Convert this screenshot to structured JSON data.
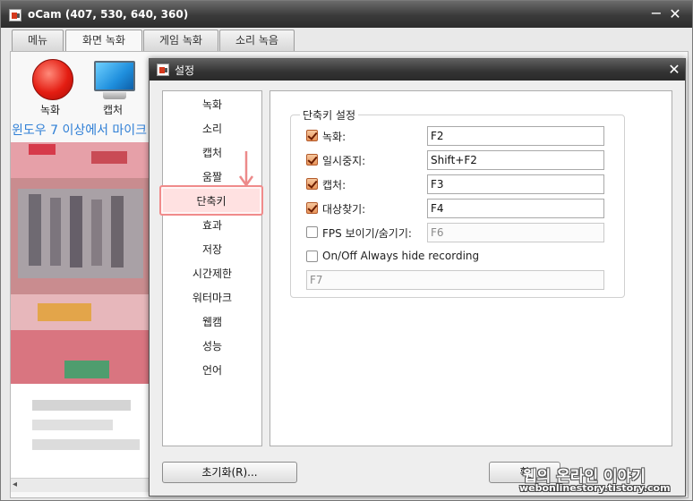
{
  "main_window": {
    "title": "oCam (407, 530, 640, 360)",
    "minimize": "−",
    "close": "✕",
    "tabs": [
      {
        "label": "메뉴"
      },
      {
        "label": "화면 녹화"
      },
      {
        "label": "게임 녹화"
      },
      {
        "label": "소리 녹음"
      }
    ],
    "toolbar": {
      "record_label": "녹화",
      "capture_label": "캡처"
    },
    "banner_text": "윈도우 7 이상에서 마이크",
    "scroll_left": "◂"
  },
  "settings_dialog": {
    "title": "설정",
    "close": "✕",
    "nav_items": [
      {
        "label": "녹화"
      },
      {
        "label": "소리"
      },
      {
        "label": "캡처"
      },
      {
        "label": "움짤"
      },
      {
        "label": "단축키",
        "selected": true
      },
      {
        "label": "효과"
      },
      {
        "label": "저장"
      },
      {
        "label": "시간제한"
      },
      {
        "label": "워터마크"
      },
      {
        "label": "웹캠"
      },
      {
        "label": "성능"
      },
      {
        "label": "언어"
      }
    ],
    "hotkeys": {
      "group_title": "단축키 설정",
      "rows": [
        {
          "label": "녹화:",
          "checked": true,
          "value": "F2"
        },
        {
          "label": "일시중지:",
          "checked": true,
          "value": "Shift+F2"
        },
        {
          "label": "캡처:",
          "checked": true,
          "value": "F3"
        },
        {
          "label": "대상찾기:",
          "checked": true,
          "value": "F4"
        },
        {
          "label": "FPS 보이기/숨기기:",
          "checked": false,
          "value": "F6"
        }
      ],
      "always_hide_label": "On/Off Always hide recording",
      "always_hide_checked": false,
      "always_hide_value": "F7"
    },
    "reset_button": "초기화(R)...",
    "confirm_button": "확"
  },
  "watermark": {
    "main": "웹의 온라인 이야기",
    "sub": "webonlinestory.tistory.com"
  },
  "colors": {
    "selected_border": "#f08b8b",
    "selected_fill": "#ffe1e1",
    "accent_arrow": "#ec8a8a",
    "banner_text": "#2f7fd6"
  }
}
